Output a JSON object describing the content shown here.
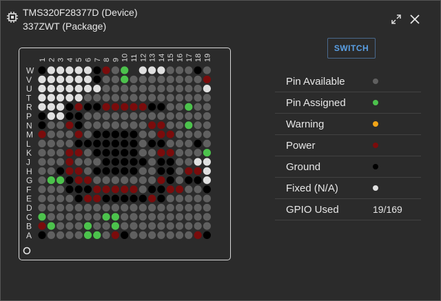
{
  "header": {
    "device_title": "TMS320F28377D (Device)",
    "package_title": "337ZWT (Package)",
    "icons": {
      "chip": "chip-icon",
      "expand": "expand-icon",
      "close": "close-icon"
    }
  },
  "switch_label": "SWITCH",
  "legend": [
    {
      "label": "Pin Available",
      "color": "#606060"
    },
    {
      "label": "Pin Assigned",
      "color": "#4cc24c"
    },
    {
      "label": "Warning",
      "color": "#f2a417"
    },
    {
      "label": "Power",
      "color": "#7a0c0c"
    },
    {
      "label": "Ground",
      "color": "#000000"
    },
    {
      "label": "Fixed (N/A)",
      "color": "#e0e0e0"
    },
    {
      "label": "GPIO Used",
      "value": "19/169"
    }
  ],
  "grid": {
    "columns": [
      "1",
      "2",
      "3",
      "4",
      "5",
      "6",
      "7",
      "8",
      "9",
      "10",
      "11",
      "12",
      "13",
      "14",
      "15",
      "16",
      "17",
      "18",
      "19"
    ],
    "rows": [
      "W",
      "V",
      "U",
      "T",
      "R",
      "P",
      "N",
      "M",
      "L",
      "K",
      "J",
      "H",
      "G",
      "F",
      "E",
      "D",
      "C",
      "B",
      "A"
    ],
    "state_colors": {
      "A": "#606060",
      "S": "#4cc24c",
      "W": "#f2a417",
      "P": "#7a0c0c",
      "G": "#000000",
      "F": "#e0e0e0",
      "N": "none"
    },
    "cells": [
      "GFFFFFGPAS FFFAAAG",
      "FFFFFFGAASAAAAAAAAP",
      "FFFFFFFAAAAAAAAAAAF",
      "FFFFFAAAAAAAAAAAAAA",
      "FFFGPGGPPPPPGGAASAA",
      "GFFGGAAAAAAAAAAAAAA",
      "GAAPGAAAAAAAPPAASAA",
      "PAAAPAGGGGGAAPPAAAA",
      "AAAAGGGGGGGAGGAAAGA",
      "AAAPPAGGGGGAAPPAAAS",
      "AAAPAAAGGGGGAGGAAFF",
      "AAGPPAGGGGGAAGGAPPF",
      "ASSGPPAAAAAAAPGAGGF",
      "AAAGGGPPPPPAGGPPAAG",
      "AAAAGPPGGGGGPGAAAAA",
      "AAAAAAAAAAAAAAAAAAA",
      "SAAAAAASSAAAAAAAAAA",
      "PSAAASAASAAAAAAAAAA",
      "GAAAASSAPGAAAAAAAPG"
    ]
  }
}
